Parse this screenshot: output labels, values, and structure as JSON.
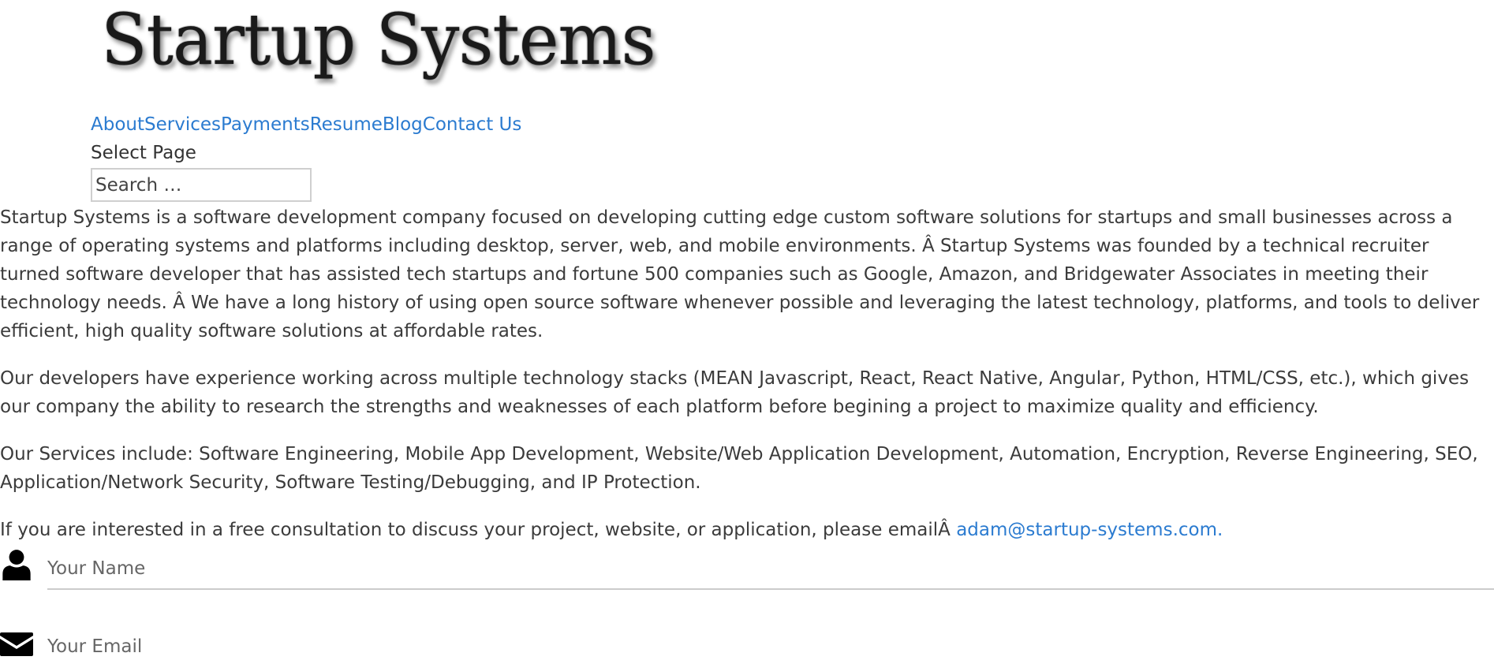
{
  "header": {
    "logo_text": "Startup Systems"
  },
  "nav": {
    "items": [
      {
        "label": "About"
      },
      {
        "label": "Services"
      },
      {
        "label": "Payments"
      },
      {
        "label": "Resume"
      },
      {
        "label": "Blog"
      },
      {
        "label": "Contact Us"
      }
    ],
    "link_color": "#2b7bd0"
  },
  "select_page": "Select Page",
  "search": {
    "placeholder": "Search …"
  },
  "content": {
    "paragraph_1": "Startup Systems is a software development company focused on developing cutting edge custom software solutions for startups and small businesses across a range of operating systems and platforms including desktop, server, web, and mobile environments. Â Startup Systems was founded by a technical recruiter turned software developer that has assisted tech startups and fortune 500 companies such as Google, Amazon, and Bridgewater Associates in meeting their technology needs. Â We have a long history of using open source software whenever possible and leveraging the latest technology, platforms, and tools to deliver efficient, high quality software solutions at affordable rates.",
    "paragraph_2": "Our developers have experience working across multiple technology stacks (MEAN Javascript, React, React Native, Angular, Python, HTML/CSS, etc.), which gives our company the ability to research the strengths and weaknesses of each platform before begining a project to maximize quality and efficiency.",
    "paragraph_3": "Our Services include: Software Engineering, Mobile App Development, Website/Web Application Development, Automation, Encryption, Reverse Engineering, SEO, Application/Network Security, Software Testing/Debugging, and IP Protection.",
    "paragraph_4_text": "If you are interested in a free consultation to discuss your project, website, or application, please emailÂ ",
    "email_link": "adam@startup-systems.com."
  },
  "form": {
    "name_placeholder": "Your Name",
    "email_placeholder": "Your Email",
    "name_icon": "user-icon",
    "email_icon": "envelope-icon"
  }
}
